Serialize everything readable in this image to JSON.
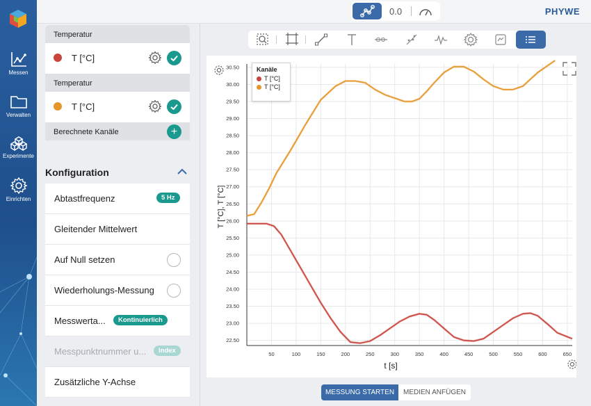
{
  "topbar": {
    "value": "0.0",
    "brand": "PHYWE"
  },
  "rail": {
    "items": [
      {
        "label": "Messen",
        "icon": "chart-line-icon"
      },
      {
        "label": "Verwalten",
        "icon": "folder-icon"
      },
      {
        "label": "Experimente",
        "icon": "cubes-icon"
      },
      {
        "label": "Einrichten",
        "icon": "gear-icon"
      }
    ]
  },
  "channels": {
    "groups": [
      {
        "title": "Temperatur",
        "label": "T [°C]",
        "color": "#c8443c"
      },
      {
        "title": "Temperatur",
        "label": "T [°C]",
        "color": "#e69528"
      }
    ],
    "calc_label": "Berechnete Kanäle"
  },
  "config": {
    "title": "Konfiguration",
    "rows": [
      {
        "label": "Abtastfrequenz",
        "badge": "5 Hz"
      },
      {
        "label": "Gleitender Mittelwert"
      },
      {
        "label": "Auf Null setzen"
      },
      {
        "label": "Wiederholungs-Messung"
      },
      {
        "label": "Messwerta...",
        "badge": "Kontinuierlich"
      },
      {
        "label": "Messpunktnummer u...",
        "badge": "Index"
      },
      {
        "label": "Zusätzliche Y-Achse"
      }
    ]
  },
  "legend": {
    "title": "Kanäle",
    "items": [
      "T [°C]",
      "T [°C]"
    ]
  },
  "buttons": {
    "start": "MESSUNG STARTEN",
    "media": "MEDIEN ANFÜGEN"
  },
  "chart_data": {
    "type": "line",
    "xlabel": "t [s]",
    "ylabel": "T [°C], T [°C]",
    "xlim": [
      0,
      660
    ],
    "ylim": [
      22.35,
      30.6
    ],
    "x_ticks": [
      50,
      100,
      150,
      200,
      250,
      300,
      350,
      400,
      450,
      500,
      550,
      600,
      650
    ],
    "y_ticks": [
      22.5,
      23.0,
      23.5,
      24.0,
      24.5,
      25.0,
      25.5,
      26.0,
      26.5,
      27.0,
      27.5,
      28.0,
      28.5,
      29.0,
      29.5,
      30.0,
      30.5
    ],
    "y_tick_labels": [
      "22.50",
      "23.00",
      "23.50",
      "24.00",
      "24.50",
      "25.00",
      "25.50",
      "26.00",
      "26.50",
      "27.00",
      "27.50",
      "28.00",
      "28.50",
      "29.00",
      "29.50",
      "30.00",
      "30.50"
    ],
    "grid": true,
    "series": [
      {
        "color": "#e69528",
        "x": [
          0,
          15,
          30,
          45,
          60,
          90,
          120,
          150,
          180,
          200,
          220,
          240,
          260,
          280,
          300,
          320,
          335,
          350,
          365,
          380,
          400,
          420,
          440,
          460,
          480,
          500,
          520,
          540,
          560,
          575,
          590,
          610,
          625
        ],
        "y": [
          26.15,
          26.2,
          26.55,
          26.95,
          27.4,
          28.1,
          28.85,
          29.55,
          29.95,
          30.1,
          30.1,
          30.05,
          29.85,
          29.7,
          29.6,
          29.5,
          29.5,
          29.58,
          29.8,
          30.05,
          30.35,
          30.52,
          30.52,
          30.38,
          30.15,
          29.95,
          29.85,
          29.85,
          29.95,
          30.15,
          30.35,
          30.55,
          30.7
        ]
      },
      {
        "color": "#c8443c",
        "x": [
          0,
          20,
          40,
          55,
          70,
          90,
          110,
          130,
          150,
          170,
          190,
          210,
          230,
          250,
          270,
          290,
          310,
          330,
          350,
          365,
          380,
          400,
          420,
          440,
          460,
          480,
          500,
          520,
          540,
          560,
          575,
          590,
          610,
          630,
          660
        ],
        "y": [
          25.92,
          25.92,
          25.92,
          25.85,
          25.6,
          25.1,
          24.6,
          24.1,
          23.6,
          23.15,
          22.75,
          22.45,
          22.42,
          22.48,
          22.65,
          22.85,
          23.05,
          23.2,
          23.28,
          23.25,
          23.1,
          22.85,
          22.6,
          22.5,
          22.48,
          22.55,
          22.75,
          22.95,
          23.15,
          23.28,
          23.3,
          23.22,
          22.98,
          22.72,
          22.55
        ]
      }
    ]
  }
}
